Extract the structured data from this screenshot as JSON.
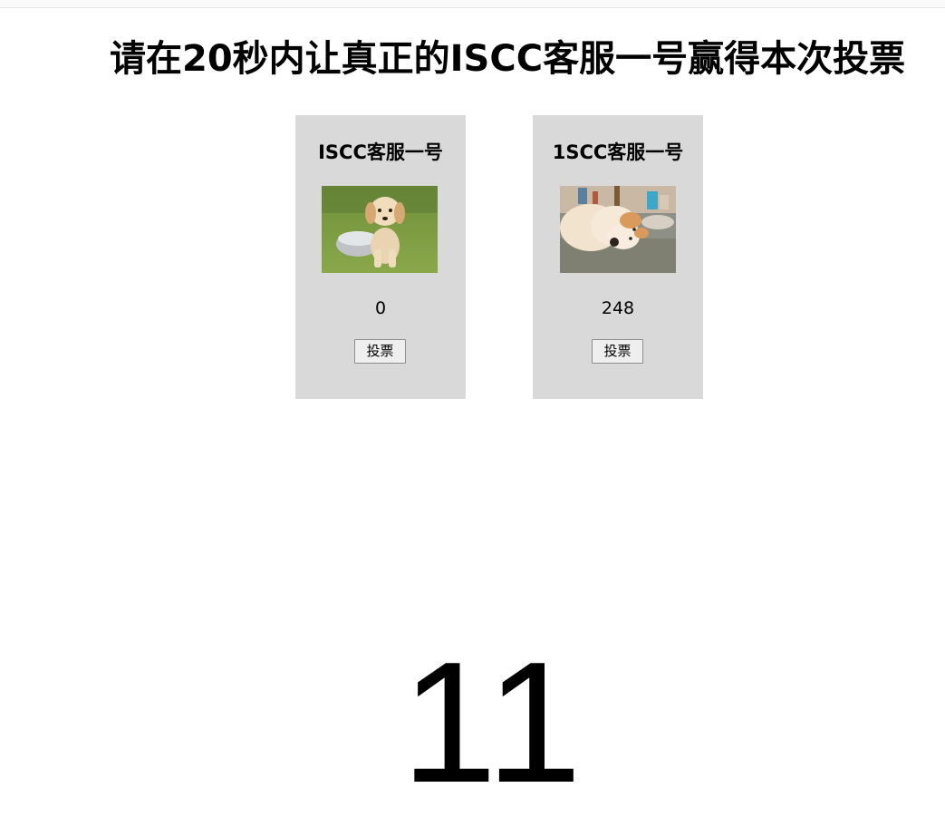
{
  "page": {
    "title": "请在20秒内让真正的ISCC客服一号赢得本次投票"
  },
  "candidates": [
    {
      "name": "ISCC客服一号",
      "image": "golden-retriever-puppy-photo",
      "votes": "0",
      "vote_label": "投票"
    },
    {
      "name": "1SCC客服一号",
      "image": "shiba-inu-lying-photo",
      "votes": "248",
      "vote_label": "投票"
    }
  ],
  "countdown": {
    "value": "11"
  },
  "colors": {
    "card_background": "#d9d9d9",
    "page_background": "#ffffff",
    "text": "#000000"
  }
}
